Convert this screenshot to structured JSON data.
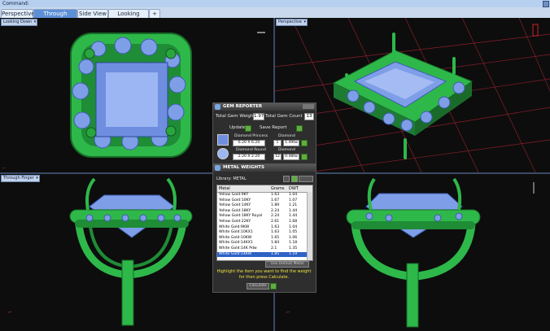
{
  "command_bar": {
    "label": "Command:"
  },
  "tabs": [
    {
      "label": "Perspective"
    },
    {
      "label": "Through Finger"
    },
    {
      "label": "Side View"
    },
    {
      "label": "Looking Down"
    },
    {
      "label": "+"
    }
  ],
  "viewports": {
    "top_left": {
      "label": "Looking Down"
    },
    "top_right": {
      "label": "Perspective"
    },
    "bottom_left": {
      "label": "Through Finger"
    },
    "bottom_right": {
      "label": ""
    }
  },
  "gem_reporter": {
    "title": "GEM REPORTER",
    "total_weight_label": "Total Gem Weight",
    "total_weight_value": "1.97",
    "total_count_label": "Total Gem Count",
    "total_count_value": "13",
    "update_label": "Update",
    "save_report_label": "Save Report",
    "gems": [
      {
        "shape": "Diamond Princess",
        "size": "6.20 X 6.20",
        "type": "Diamond",
        "count": "1",
        "weight": "1.49tw"
      },
      {
        "shape": "Diamond Round",
        "size": "2.20 X 2.20",
        "type": "Diamond",
        "count": "12",
        "weight": "0.48tw"
      }
    ]
  },
  "metal_weights": {
    "title": "METAL WEIGHTS",
    "library_label": "Library: METAL",
    "columns": [
      "Metal",
      "Grams",
      "DWT"
    ],
    "rows": [
      {
        "metal": "Yellow Gold:9KY",
        "grams": "1.63",
        "dwt": "1.04"
      },
      {
        "metal": "Yellow Gold:10KY",
        "grams": "1.67",
        "dwt": "1.07"
      },
      {
        "metal": "Yellow Gold:14KY",
        "grams": "1.89",
        "dwt": "1.21"
      },
      {
        "metal": "Yellow Gold:18KY",
        "grams": "2.24",
        "dwt": "1.44"
      },
      {
        "metal": "Yellow Gold:18KY Royal",
        "grams": "2.24",
        "dwt": "1.44"
      },
      {
        "metal": "Yellow Gold:22KY",
        "grams": "2.61",
        "dwt": "1.68"
      },
      {
        "metal": "White Gold:9KW",
        "grams": "1.63",
        "dwt": "1.04"
      },
      {
        "metal": "White Gold:10KX1",
        "grams": "1.63",
        "dwt": "1.05"
      },
      {
        "metal": "White Gold:10KW",
        "grams": "1.65",
        "dwt": "1.06"
      },
      {
        "metal": "White Gold:14KX1",
        "grams": "1.84",
        "dwt": "1.18"
      },
      {
        "metal": "White Gold:14K Pdw",
        "grams": "2.1",
        "dwt": "1.35"
      },
      {
        "metal": "White Gold:14KW",
        "grams": "1.85",
        "dwt": "1.19"
      }
    ],
    "selected_row_index": 11,
    "use_default_button": "Use Default Metal",
    "hint": "Highlight the item you want to find the weight for then press Calculate.",
    "calculate_label": "Calculate"
  },
  "colors": {
    "metal_green": "#2eb84a",
    "gem_blue": "#7f9ee8",
    "grid_line": "#8a1f2a",
    "panel_bg": "#2e2e2e",
    "tab_active": "#5c8fd6"
  }
}
